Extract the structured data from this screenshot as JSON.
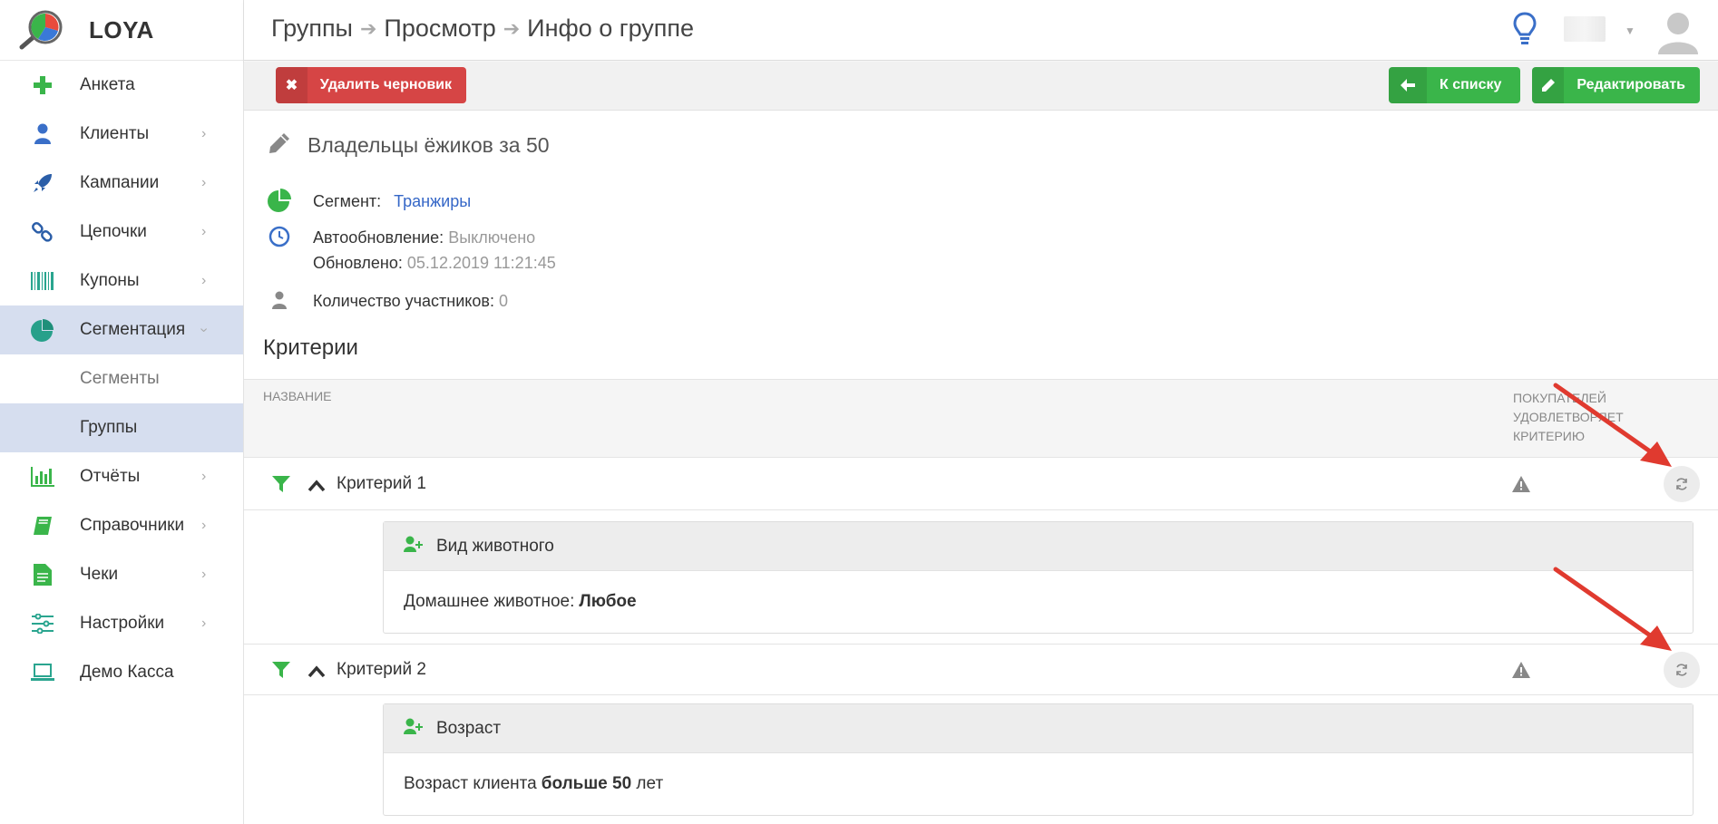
{
  "app": {
    "name": "LOYA"
  },
  "sidebar": {
    "items": [
      {
        "label": "Анкета",
        "icon": "plus-icon"
      },
      {
        "label": "Клиенты",
        "icon": "user-icon"
      },
      {
        "label": "Кампании",
        "icon": "rocket-icon"
      },
      {
        "label": "Цепочки",
        "icon": "chain-icon"
      },
      {
        "label": "Купоны",
        "icon": "barcode-icon"
      },
      {
        "label": "Сегментация",
        "icon": "pie-chart-icon"
      },
      {
        "label": "Сегменты"
      },
      {
        "label": "Группы"
      },
      {
        "label": "Отчёты",
        "icon": "bar-chart-icon"
      },
      {
        "label": "Справочники",
        "icon": "book-icon"
      },
      {
        "label": "Чеки",
        "icon": "document-icon"
      },
      {
        "label": "Настройки",
        "icon": "sliders-icon"
      },
      {
        "label": "Демо Касса",
        "icon": "laptop-icon"
      }
    ]
  },
  "header": {
    "breadcrumb": [
      "Группы",
      "Просмотр",
      "Инфо о группе"
    ]
  },
  "toolbar": {
    "delete_draft": "Удалить черновик",
    "back_to_list": "К списку",
    "edit": "Редактировать"
  },
  "group": {
    "title": "Владельцы ёжиков за 50",
    "segment_label": "Сегмент:",
    "segment_value": "Транжиры",
    "autoupdate_label": "Автообновление:",
    "autoupdate_value": "Выключено",
    "updated_label": "Обновлено:",
    "updated_value": "05.12.2019 11:21:45",
    "members_label": "Количество участников:",
    "members_value": "0"
  },
  "criteria": {
    "section_title": "Критерии",
    "col_name": "Название",
    "col_buyers": "Покупателей удовлетворяет критерию",
    "rows": [
      {
        "name": "Критерий 1",
        "card_title": "Вид животного",
        "card_text": "Домашнее животное:",
        "card_value": "Любое"
      },
      {
        "name": "Критерий 2",
        "card_title": "Возраст",
        "card_text": "Возраст клиента",
        "card_value": "больше 50",
        "card_suffix": " лет"
      }
    ]
  },
  "colors": {
    "accent_green": "#3ab54a",
    "danger_red": "#d64545",
    "link_blue": "#3567c7",
    "active_bg": "#d6deef",
    "annotation_arrow": "#e03a2f"
  }
}
